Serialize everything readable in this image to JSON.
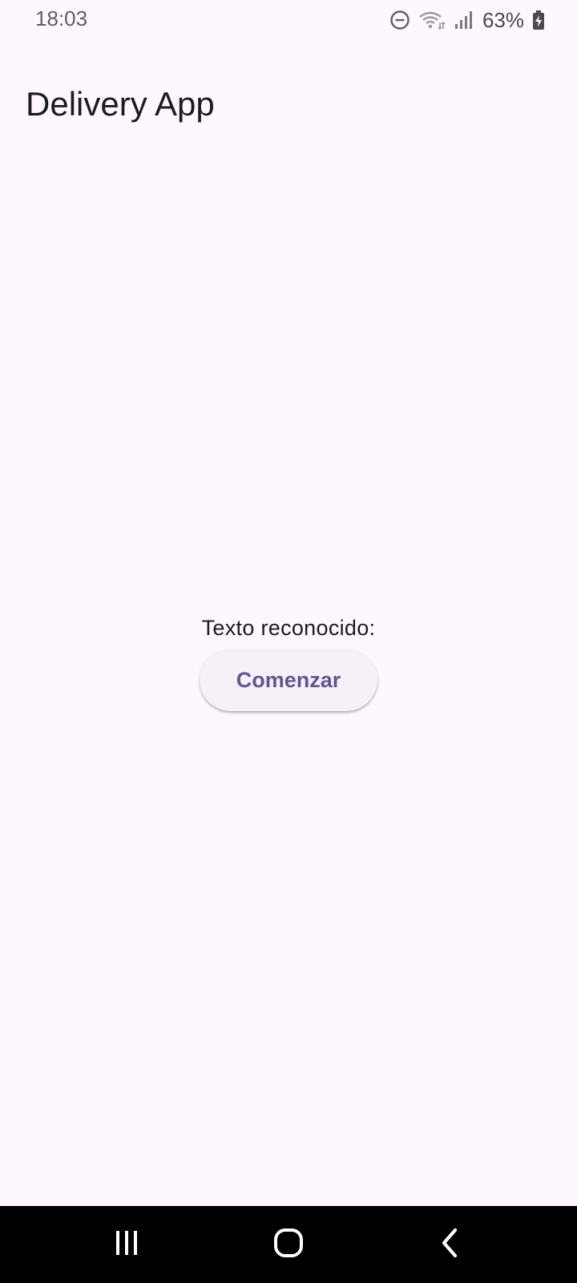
{
  "status_bar": {
    "time": "18:03",
    "battery": "63%",
    "icons": [
      "do-not-disturb-icon",
      "wifi-icon",
      "signal-icon",
      "battery-charging-icon"
    ]
  },
  "app_bar": {
    "title": "Delivery App"
  },
  "main": {
    "recognized_label": "Texto reconocido:",
    "start_button_label": "Comenzar"
  },
  "nav_bar": {
    "icons": [
      "recents-icon",
      "home-icon",
      "back-icon"
    ]
  },
  "colors": {
    "background": "#FEF7FF",
    "button_background": "#F6F1F8",
    "button_text": "#65558F",
    "text_primary": "#1D1B20",
    "nav_background": "#000000"
  }
}
